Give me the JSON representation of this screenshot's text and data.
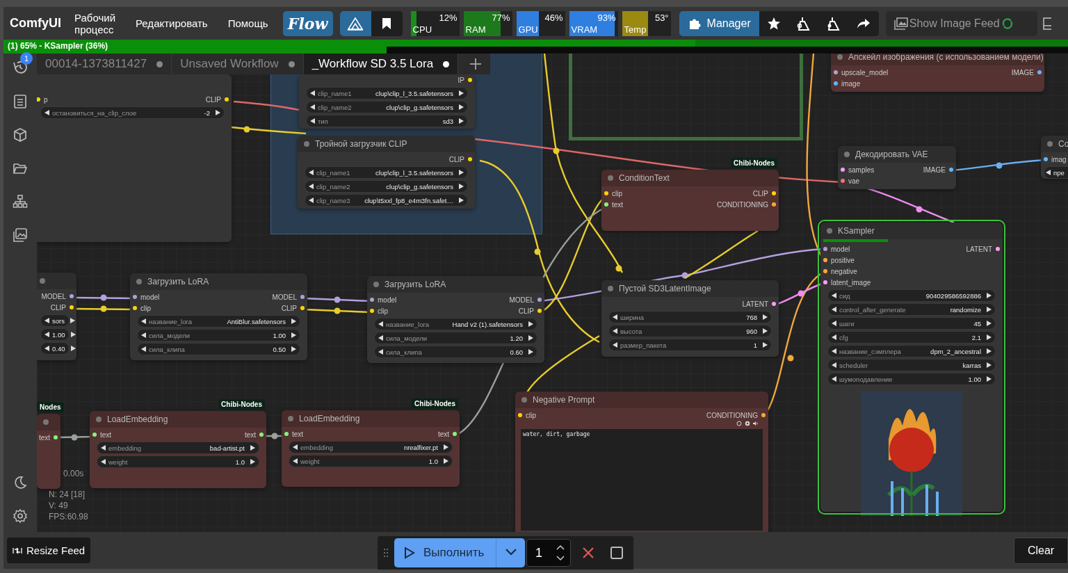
{
  "menubar": {
    "logo": "ComfyUI",
    "menus": [
      "Рабочий процесс",
      "Редактировать",
      "Помощь"
    ],
    "flow_button": "Flow",
    "monitors": [
      {
        "label": "CPU",
        "value": "12%",
        "level": 0.12,
        "color": "#1c8c1c"
      },
      {
        "label": "RAM",
        "value": "77%",
        "level": 0.77,
        "color": "#1c7a1c"
      },
      {
        "label": "GPU",
        "value": "46%",
        "level": 0.46,
        "color": "#2f7fe0"
      },
      {
        "label": "VRAM",
        "value": "93%",
        "level": 0.93,
        "color": "#2f7fe0"
      },
      {
        "label": "Temp",
        "value": "53°",
        "level": 0.53,
        "color": "#9a8a10"
      }
    ],
    "manager_button": "Manager",
    "image_feed_button": "Show Image Feed"
  },
  "progress": {
    "text": "(1) 65% - KSampler (36%)",
    "bars": [
      {
        "level": 0.65
      },
      {
        "level": 0.36
      }
    ]
  },
  "tabs": [
    {
      "label": "00014-1373811427",
      "selected": false
    },
    {
      "label": "Unsaved Workflow",
      "selected": false
    },
    {
      "label": "_Workflow SD 3.5 Lora",
      "selected": true
    }
  ],
  "sidebar": {
    "history_badge": "1"
  },
  "groups": [
    {
      "color": "#2a3c4f"
    },
    {
      "color": "#3f6f3f"
    }
  ],
  "nodes": [
    {
      "color": "#353535",
      "executing": false,
      "inputs": [
        {
          "name": "p",
          "color": "#ffd500"
        }
      ],
      "outputs": [
        {
          "name": "CLIP",
          "color": "#ffd500"
        }
      ],
      "widgets": [
        {
          "name": "остановиться_на_clip_слое",
          "value": "-2"
        }
      ]
    },
    {
      "color": "#353535",
      "executing": false,
      "outputs": [
        {
          "name": "IP",
          "color": "#ffd500"
        }
      ],
      "widgets": [
        {
          "name": "clip_name1",
          "value": "clup\\clip_l_3.5.safetensors"
        },
        {
          "name": "clip_name2",
          "value": "clup\\clip_g.safetensors"
        },
        {
          "name": "тип",
          "value": "sd3"
        }
      ]
    },
    {
      "title": "Тройной загрузчик CLIP",
      "color": "#353535",
      "executing": false,
      "outputs": [
        {
          "name": "CLIP",
          "color": "#ffd500"
        }
      ],
      "widgets": [
        {
          "name": "clip_name1",
          "value": "clup\\clip_l_3.5.safetensors"
        },
        {
          "name": "clip_name2",
          "value": "clup\\clip_g.safetensors"
        },
        {
          "name": "clip_name3",
          "value": "clup\\t5xxl_fp8_e4m3fn.safet…"
        }
      ]
    },
    {
      "title": "Апскейл изображения (с использованием модели)",
      "color": "#553333",
      "executing": false,
      "inputs": [
        {
          "name": "upscale_model",
          "color": "#b0a0d0"
        },
        {
          "name": "image",
          "color": "#64b5f6"
        }
      ],
      "outputs": [
        {
          "name": "IMAGE",
          "color": "#64b5f6"
        }
      ]
    },
    {
      "title": "Декодировать VAE",
      "color": "#353535",
      "executing": false,
      "inputs": [
        {
          "name": "samples",
          "color": "#ff9cf9"
        },
        {
          "name": "vae",
          "color": "#ff6e6e"
        }
      ],
      "outputs": [
        {
          "name": "IMAGE",
          "color": "#64b5f6"
        }
      ]
    },
    {
      "title": "Co",
      "color": "#353535",
      "executing": false,
      "inputs": [
        {
          "name": "imag",
          "color": "#64b5f6"
        }
      ],
      "widgets": [
        {
          "value": "пре"
        }
      ]
    },
    {
      "title": "ConditionText",
      "badge": "Chibi-Nodes",
      "color": "#553333",
      "executing": false,
      "inputs": [
        {
          "name": "clip",
          "color": "#ffd500"
        },
        {
          "name": "text",
          "color": "#7cfc7c"
        }
      ],
      "outputs": [
        {
          "name": "CLIP",
          "color": "#ffd500"
        },
        {
          "name": "CONDITIONING",
          "color": "#ffa931"
        }
      ]
    },
    {
      "title": "KSampler",
      "color": "#353535",
      "executing": true,
      "level": 0.36,
      "inputs": [
        {
          "name": "model",
          "color": "#b39ddb"
        },
        {
          "name": "positive",
          "color": "#ffa931"
        },
        {
          "name": "negative",
          "color": "#ffa931"
        },
        {
          "name": "latent_image",
          "color": "#ff9cf9"
        }
      ],
      "outputs": [
        {
          "name": "LATENT",
          "color": "#ff9cf9"
        }
      ],
      "widgets": [
        {
          "name": "сид",
          "value": "904029586592886"
        },
        {
          "name": "control_after_generate",
          "value": "randomize"
        },
        {
          "name": "шаги",
          "value": "45"
        },
        {
          "name": "cfg",
          "value": "2.1"
        },
        {
          "name": "название_сэмплера",
          "value": "dpm_2_ancestral"
        },
        {
          "name": "scheduler",
          "value": "karras"
        },
        {
          "name": "шумоподавление",
          "value": "1.00"
        }
      ],
      "preview": true
    },
    {
      "color": "#353535",
      "executing": false,
      "outputs": [
        {
          "name": "MODEL",
          "color": "#b39ddb"
        },
        {
          "name": "CLIP",
          "color": "#ffd500"
        }
      ],
      "widgets": [
        {
          "value": "sors"
        },
        {
          "value": "1.00"
        },
        {
          "value": "0.40"
        }
      ]
    },
    {
      "title": "Загрузить LoRA",
      "color": "#353535",
      "executing": false,
      "inputs": [
        {
          "name": "model",
          "color": "#b39ddb"
        },
        {
          "name": "clip",
          "color": "#ffd500"
        }
      ],
      "outputs": [
        {
          "name": "MODEL",
          "color": "#b39ddb"
        },
        {
          "name": "CLIP",
          "color": "#ffd500"
        }
      ],
      "widgets": [
        {
          "name": "название_lora",
          "value": "AntiBlur.safetensors"
        },
        {
          "name": "сила_модели",
          "value": "1.00"
        },
        {
          "name": "сила_клипа",
          "value": "0.50"
        }
      ]
    },
    {
      "title": "Загрузить LoRA",
      "color": "#353535",
      "executing": false,
      "inputs": [
        {
          "name": "model",
          "color": "#b39ddb"
        },
        {
          "name": "clip",
          "color": "#ffd500"
        }
      ],
      "outputs": [
        {
          "name": "MODEL",
          "color": "#b39ddb"
        },
        {
          "name": "CLIP",
          "color": "#ffd500"
        }
      ],
      "widgets": [
        {
          "name": "название_lora",
          "value": "Hand v2 (1).safetensors"
        },
        {
          "name": "сила_модели",
          "value": "1.20"
        },
        {
          "name": "сила_клипа",
          "value": "0.60"
        }
      ]
    },
    {
      "title": "Пустой SD3LatentImage",
      "color": "#353535",
      "executing": false,
      "outputs": [
        {
          "name": "LATENT",
          "color": "#ff9cf9"
        }
      ],
      "widgets": [
        {
          "name": "ширина",
          "value": "768"
        },
        {
          "name": "высота",
          "value": "960"
        },
        {
          "name": "размер_пакета",
          "value": "1"
        }
      ]
    },
    {
      "badge": "Nodes",
      "color": "#553333",
      "executing": false,
      "outputs": [
        {
          "name": "text",
          "color": "#7cfc7c"
        }
      ]
    },
    {
      "title": "LoadEmbedding",
      "badge": "Chibi-Nodes",
      "color": "#553333",
      "executing": false,
      "inputs": [
        {
          "name": "text",
          "color": "#7cfc7c"
        }
      ],
      "outputs": [
        {
          "name": "text",
          "color": "#7cfc7c"
        }
      ],
      "widgets": [
        {
          "name": "embedding",
          "value": "bad-artist.pt"
        },
        {
          "name": "weight",
          "value": "1.0"
        }
      ]
    },
    {
      "title": "LoadEmbedding",
      "badge": "Chibi-Nodes",
      "color": "#553333",
      "executing": false,
      "inputs": [
        {
          "name": "text",
          "color": "#7cfc7c"
        }
      ],
      "outputs": [
        {
          "name": "text",
          "color": "#7cfc7c"
        }
      ],
      "widgets": [
        {
          "name": "embedding",
          "value": "nrealfixer.pt"
        },
        {
          "name": "weight",
          "value": "1.0"
        }
      ]
    },
    {
      "title": "Negative Prompt",
      "color": "#553333",
      "executing": false,
      "inputs": [
        {
          "name": "clip",
          "color": "#ffd500"
        }
      ],
      "outputs": [
        {
          "name": "CONDITIONING",
          "color": "#ffa931"
        }
      ],
      "text": "water, dirt, garbage"
    }
  ],
  "stats": {
    "time": "0.00s",
    "nodes": "N: 24 [18]",
    "vertices": "V: 49",
    "fps": "FPS:60.98"
  },
  "bottom": {
    "resize_button": "Resize Feed",
    "run_button": "Выполнить",
    "batch_count": "1",
    "clear_button": "Clear"
  }
}
